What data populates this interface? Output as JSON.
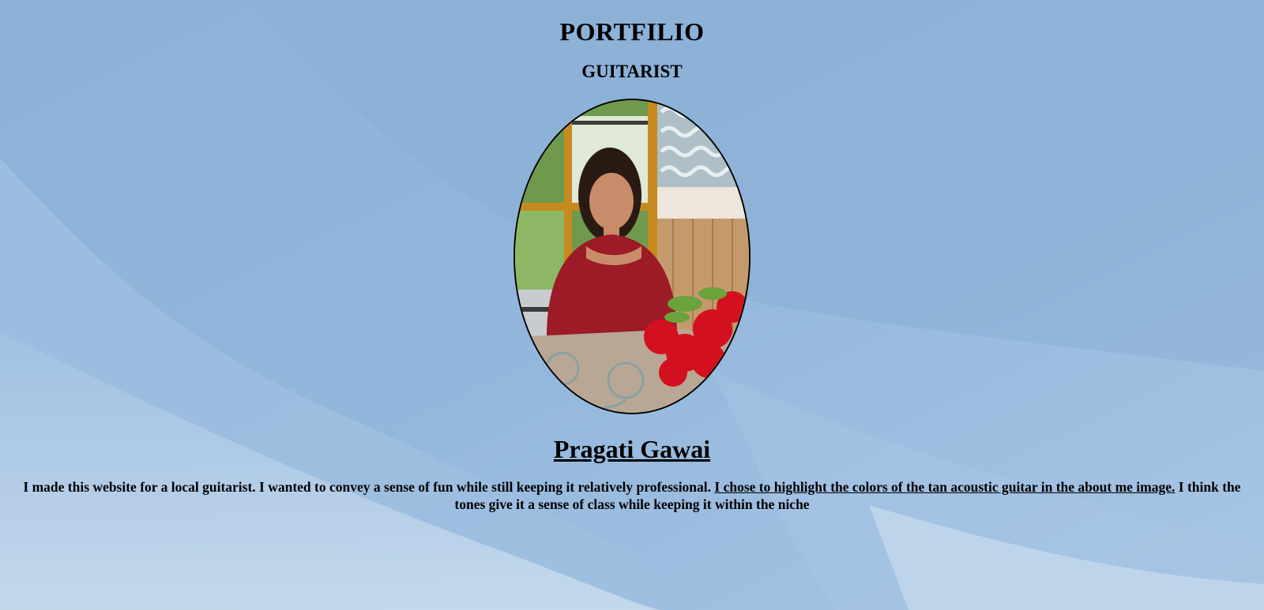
{
  "header": {
    "title": "PORTFILIO",
    "subtitle": "GUITARIST"
  },
  "profile": {
    "photo": "profile-photo",
    "name": "Pragati Gawai"
  },
  "about": {
    "text_before": "I made this website for a local guitarist. I wanted to convey a sense of fun while still keeping it relatively professional. ",
    "link_text": "I chose to highlight the colors of the tan acoustic guitar in the about me image.",
    "text_after": " I think the tones give it a sense of class while keeping it within the niche"
  },
  "colors": {
    "background": "#8fb1d6",
    "text": "#000000"
  }
}
